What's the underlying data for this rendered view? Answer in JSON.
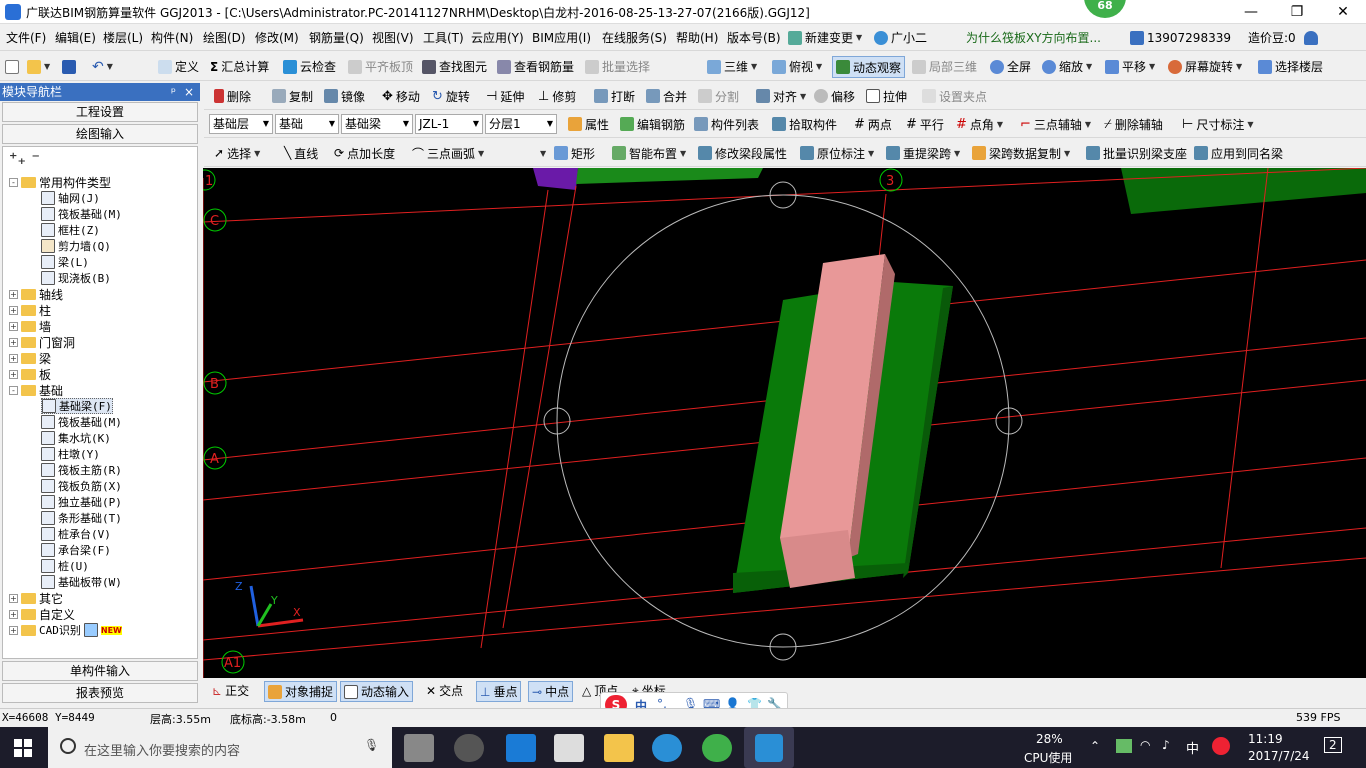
{
  "window": {
    "title": "广联达BIM钢筋算量软件 GGJ2013 - [C:\\Users\\Administrator.PC-20141127NRHM\\Desktop\\白龙村-2016-08-25-13-27-07(2166版).GGJ12]",
    "badge": "68"
  },
  "menu": [
    "文件(F)",
    "编辑(E)",
    "楼层(L)",
    "构件(N)",
    "绘图(D)",
    "修改(M)",
    "钢筋量(Q)",
    "视图(V)",
    "工具(T)",
    "云应用(Y)",
    "BIM应用(I)",
    "在线服务(S)",
    "帮助(H)",
    "版本号(B)",
    "新建变更",
    "广小二",
    "为什么筏板XY方向布置...",
    "13907298339",
    "造价豆:0"
  ],
  "toolbar1": [
    "定义",
    "汇总计算",
    "云检查",
    "平齐板顶",
    "查找图元",
    "查看钢筋量",
    "批量选择",
    "三维",
    "俯视",
    "动态观察",
    "局部三维",
    "全屏",
    "缩放",
    "平移",
    "屏幕旋转",
    "选择楼层"
  ],
  "nav": {
    "title": "模块导航栏",
    "pin": "ᵖ",
    "close": "×",
    "project_settings": "工程设置",
    "drawing_input": "绘图输入",
    "single_input": "单构件输入",
    "report_preview": "报表预览"
  },
  "tree": {
    "common": "常用构件类型",
    "common_items": [
      "轴网(J)",
      "筏板基础(M)",
      "框柱(Z)",
      "剪力墙(Q)",
      "梁(L)",
      "现浇板(B)"
    ],
    "groups_a": [
      "轴线",
      "柱",
      "墙",
      "门窗洞",
      "梁",
      "板"
    ],
    "foundation": "基础",
    "foundation_items": [
      "基础梁(F)",
      "筏板基础(M)",
      "集水坑(K)",
      "柱墩(Y)",
      "筏板主筋(R)",
      "筏板负筋(X)",
      "独立基础(P)",
      "条形基础(T)",
      "桩承台(V)",
      "承台梁(F)",
      "桩(U)",
      "基础板带(W)"
    ],
    "groups_b": [
      "其它",
      "自定义",
      "CAD识别"
    ],
    "new_tag": "NEW"
  },
  "toolbar2": [
    "删除",
    "复制",
    "镜像",
    "移动",
    "旋转",
    "延伸",
    "修剪",
    "打断",
    "合并",
    "分割",
    "对齐",
    "偏移",
    "拉伸",
    "设置夹点"
  ],
  "toolbar3": {
    "selects": [
      "基础层",
      "基础",
      "基础梁",
      "JZL-1",
      "分层1"
    ],
    "buttons": [
      "属性",
      "编辑钢筋",
      "构件列表",
      "拾取构件",
      "两点",
      "平行",
      "点角",
      "三点辅轴",
      "删除辅轴",
      "尺寸标注"
    ]
  },
  "toolbar4": [
    "选择",
    "直线",
    "点加长度",
    "三点画弧",
    "矩形",
    "智能布置",
    "修改梁段属性",
    "原位标注",
    "重提梁跨",
    "梁跨数据复制",
    "批量识别梁支座",
    "应用到同名梁"
  ],
  "canvas": {
    "axis_labels": [
      "1",
      "3",
      "C",
      "B",
      "A",
      "A1"
    ],
    "axis_x": "X",
    "axis_y": "Y",
    "axis_z": "Z"
  },
  "bottombar": [
    "正交",
    "对象捕捉",
    "动态输入",
    "交点",
    "垂点",
    "中点",
    "顶点",
    "坐标"
  ],
  "ime": {
    "s": "S",
    "lang": "中",
    "punct": "°,"
  },
  "status": {
    "coords": "X=46608 Y=8449",
    "floor_h": "层高:3.55m",
    "bottom_h": "底标高:-3.58m",
    "zero": "0",
    "fps": "539 FPS"
  },
  "taskbar": {
    "search_placeholder": "在这里输入你要搜索的内容",
    "cpu_pct": "28%",
    "cpu_label": "CPU使用",
    "ime": "中",
    "time": "11:19",
    "date": "2017/7/24",
    "notif": "2"
  },
  "colors": {
    "canvas": "#000000",
    "grid": "#e02020",
    "beam": "#e89898",
    "slab": "#0a7a0a",
    "accent": "#3a70c0"
  }
}
